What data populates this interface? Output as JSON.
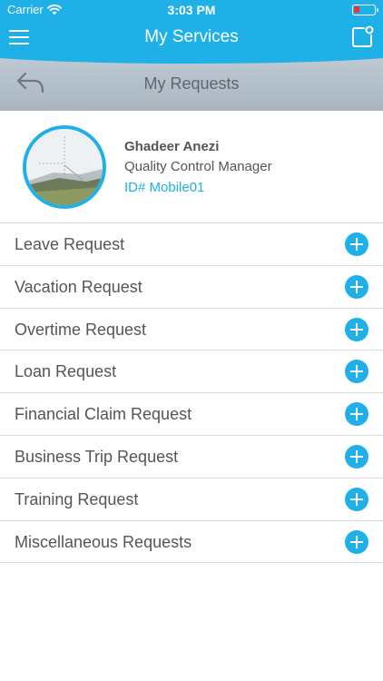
{
  "status_bar": {
    "carrier": "Carrier",
    "time": "3:03 PM"
  },
  "nav": {
    "title": "My Services",
    "accent_color": "#1fb0e8"
  },
  "sub_header": {
    "title": "My Requests"
  },
  "profile": {
    "name": "Ghadeer Anezi",
    "role": "Quality Control Manager",
    "id": "ID# Mobile01"
  },
  "requests": [
    {
      "label": "Leave Request"
    },
    {
      "label": "Vacation Request"
    },
    {
      "label": "Overtime Request"
    },
    {
      "label": "Loan Request"
    },
    {
      "label": "Financial Claim Request"
    },
    {
      "label": "Business Trip Request"
    },
    {
      "label": "Training Request"
    },
    {
      "label": "Miscellaneous Requests"
    }
  ]
}
